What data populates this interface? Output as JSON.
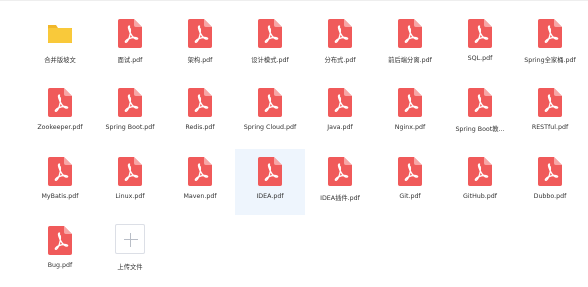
{
  "files": [
    {
      "name": "合并版坡文",
      "type": "folder"
    },
    {
      "name": "面试.pdf",
      "type": "pdf"
    },
    {
      "name": "架构.pdf",
      "type": "pdf"
    },
    {
      "name": "设计模式.pdf",
      "type": "pdf"
    },
    {
      "name": "分布式.pdf",
      "type": "pdf"
    },
    {
      "name": "前后端分离.pdf",
      "type": "pdf"
    },
    {
      "name": "SQL.pdf",
      "type": "pdf"
    },
    {
      "name": "Spring全家桶.pdf",
      "type": "pdf"
    },
    {
      "name": "Zookeeper.pdf",
      "type": "pdf"
    },
    {
      "name": "Spring Boot.pdf",
      "type": "pdf"
    },
    {
      "name": "Redis.pdf",
      "type": "pdf"
    },
    {
      "name": "Spring Cloud.pdf",
      "type": "pdf"
    },
    {
      "name": "Java.pdf",
      "type": "pdf"
    },
    {
      "name": "Nginx.pdf",
      "type": "pdf"
    },
    {
      "name": "Spring Boot教...",
      "type": "pdf"
    },
    {
      "name": "RESTful.pdf",
      "type": "pdf"
    },
    {
      "name": "MyBatis.pdf",
      "type": "pdf"
    },
    {
      "name": "Linux.pdf",
      "type": "pdf"
    },
    {
      "name": "Maven.pdf",
      "type": "pdf"
    },
    {
      "name": "IDEA.pdf",
      "type": "pdf",
      "selected": true
    },
    {
      "name": "IDEA插件.pdf",
      "type": "pdf"
    },
    {
      "name": "Git.pdf",
      "type": "pdf"
    },
    {
      "name": "GitHub.pdf",
      "type": "pdf"
    },
    {
      "name": "Dubbo.pdf",
      "type": "pdf"
    },
    {
      "name": "Bug.pdf",
      "type": "pdf"
    },
    {
      "name": "上传文件",
      "type": "upload"
    }
  ],
  "colors": {
    "pdf_red": "#f05a5a",
    "pdf_fold": "#f7a6a6",
    "folder_yellow": "#f9c93a",
    "folder_tab": "#f1b72a",
    "selected_bg": "#eef5fd"
  },
  "icons": {
    "pdf": "pdf-file-icon",
    "folder": "folder-icon",
    "upload": "plus-icon"
  }
}
